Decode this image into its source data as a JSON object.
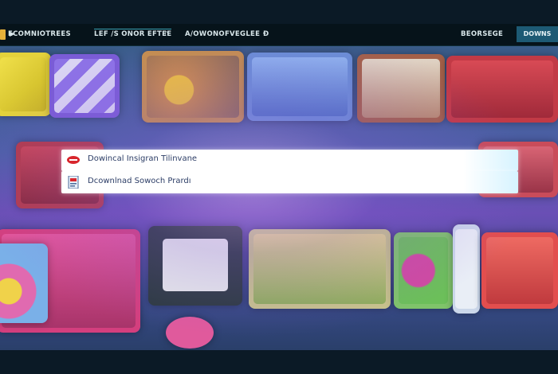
{
  "header": {
    "brand": "ECOMNIOTREES",
    "nav": [
      "LEF /S ONOR EFTEE",
      "A/OWONOFVEGLEE"
    ],
    "right_link": "BEORSEGE",
    "cta_label": "DOWNS"
  },
  "suggestions": [
    {
      "label": "Dowincal Insigran Tilinvane",
      "icon": "red-pill-icon"
    },
    {
      "label": "Dcownlnad Sowoch Prardı",
      "icon": "document-icon"
    }
  ],
  "colors": {
    "topbar": "#06131a",
    "cta": "#1d5a74",
    "suggestion_text": "#2c3d66",
    "brand_accent": "#e8b23a"
  }
}
